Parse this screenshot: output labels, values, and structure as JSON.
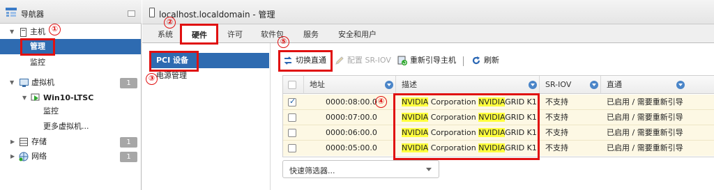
{
  "navigator": {
    "title": "导航器",
    "items": [
      {
        "label": "主机"
      },
      {
        "label": "管理"
      },
      {
        "label": "监控"
      },
      {
        "label": "虚拟机",
        "badge": "1"
      },
      {
        "label": "Win10-LTSC"
      },
      {
        "label": "监控"
      },
      {
        "label": "更多虚拟机..."
      },
      {
        "label": "存储",
        "badge": "1"
      },
      {
        "label": "网络",
        "badge": "1"
      }
    ]
  },
  "header": {
    "title": "localhost.localdomain - 管理"
  },
  "tabs": [
    "系统",
    "硬件",
    "许可",
    "软件包",
    "服务",
    "安全和用户"
  ],
  "subnav": [
    "PCI 设备",
    "电源管理"
  ],
  "toolbar": {
    "toggle": "切换直通",
    "sriov": "配置 SR-IOV",
    "reboot": "重新引导主机",
    "refresh": "刷新"
  },
  "table": {
    "headers": [
      "地址",
      "描述",
      "SR-IOV",
      "直通"
    ],
    "rows": [
      {
        "address": "0000:08:00.0",
        "desc_a": "NVIDIA",
        "desc_b": " Corporation ",
        "desc_c": "NVIDIA",
        "desc_d": "GRID K1",
        "sriov": "不支持",
        "pass": "已启用 / 需要重新引导",
        "checked": true
      },
      {
        "address": "0000:07:00.0",
        "desc_a": "NVIDIA",
        "desc_b": " Corporation ",
        "desc_c": "NVIDIA",
        "desc_d": "GRID K1",
        "sriov": "不支持",
        "pass": "已启用 / 需要重新引导",
        "checked": false
      },
      {
        "address": "0000:06:00.0",
        "desc_a": "NVIDIA",
        "desc_b": " Corporation ",
        "desc_c": "NVIDIA",
        "desc_d": "GRID K1",
        "sriov": "不支持",
        "pass": "已启用 / 需要重新引导",
        "checked": false
      },
      {
        "address": "0000:05:00.0",
        "desc_a": "NVIDIA",
        "desc_b": " Corporation ",
        "desc_c": "NVIDIA",
        "desc_d": "GRID K1",
        "sriov": "不支持",
        "pass": "已启用 / 需要重新引导",
        "checked": false
      }
    ]
  },
  "filter": {
    "placeholder": "快速筛选器..."
  },
  "annotations": [
    "①",
    "②",
    "③",
    "④",
    "⑤"
  ],
  "colors": {
    "selection": "#2e6bb1",
    "annotation": "#e01010",
    "highlight": "#ffff3d",
    "row": "#fdf8e4"
  }
}
